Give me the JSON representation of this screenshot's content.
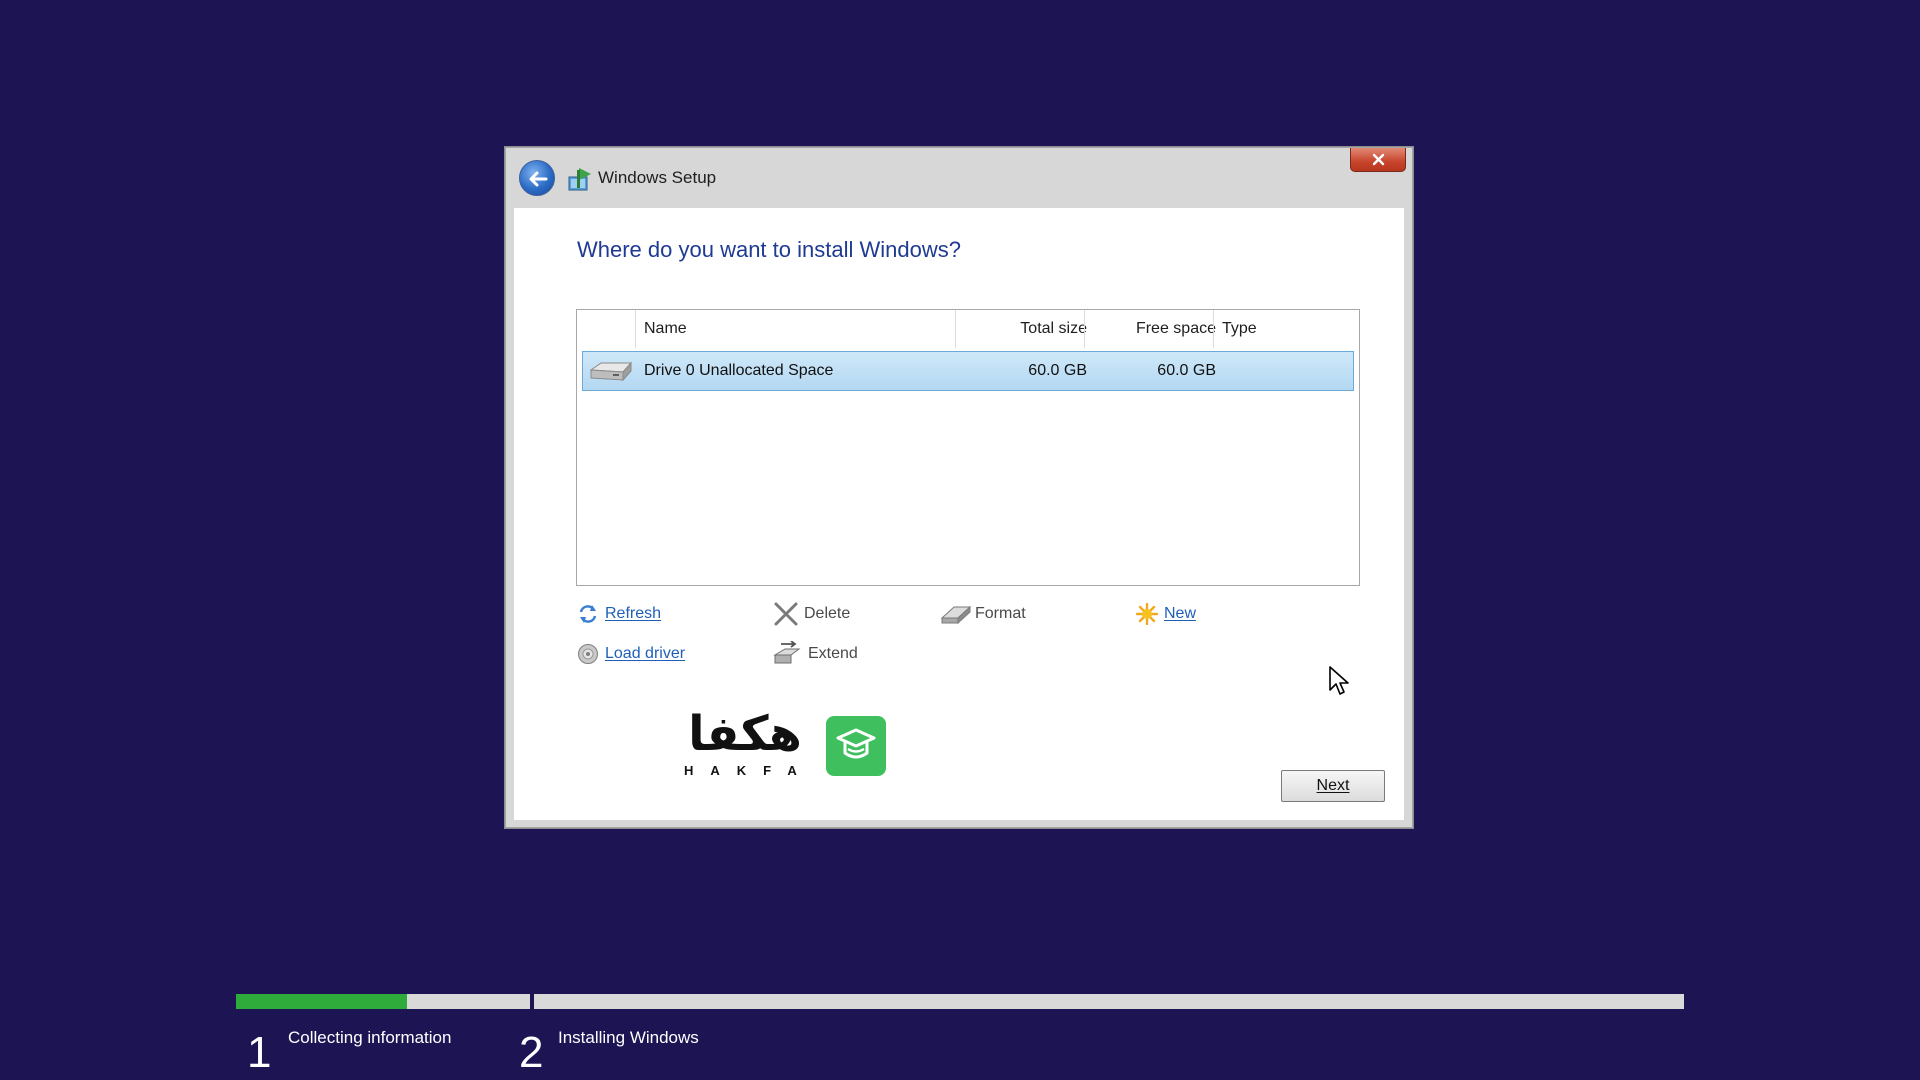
{
  "window": {
    "title": "Windows Setup",
    "close_label": "Close"
  },
  "page": {
    "heading": "Where do you want to install Windows?"
  },
  "partitions": {
    "columns": {
      "name": "Name",
      "total_size": "Total size",
      "free_space": "Free space",
      "type": "Type"
    },
    "rows": [
      {
        "name": "Drive 0 Unallocated Space",
        "total_size": "60.0 GB",
        "free_space": "60.0 GB",
        "type": "",
        "selected": true
      }
    ]
  },
  "actions": {
    "refresh": "Refresh",
    "delete": "Delete",
    "format": "Format",
    "new": "New",
    "load_driver": "Load driver",
    "extend": "Extend"
  },
  "logo": {
    "arabic_text": "هكفا",
    "latin_text": "HAKFA"
  },
  "buttons": {
    "next": "Next"
  },
  "progress": {
    "steps": [
      {
        "number": "1",
        "label": "Collecting information",
        "fill_fraction": 0.58
      },
      {
        "number": "2",
        "label": "Installing Windows",
        "fill_fraction": 0.0
      }
    ]
  },
  "colors": {
    "background": "#1d1454",
    "heading": "#1f3a93",
    "link": "#1f5fb8",
    "progress_fill": "#2fab3c",
    "selection": "#b3d8f2",
    "logo_badge": "#3fbf5e"
  },
  "icons": {
    "back": "back-arrow-icon",
    "setup": "windows-setup-icon",
    "close": "close-icon",
    "drive": "hard-drive-icon",
    "refresh": "refresh-icon",
    "delete": "delete-x-icon",
    "format": "format-eraser-icon",
    "new": "new-star-icon",
    "load_driver": "disc-icon",
    "extend": "extend-icon",
    "cursor": "mouse-pointer-icon"
  }
}
